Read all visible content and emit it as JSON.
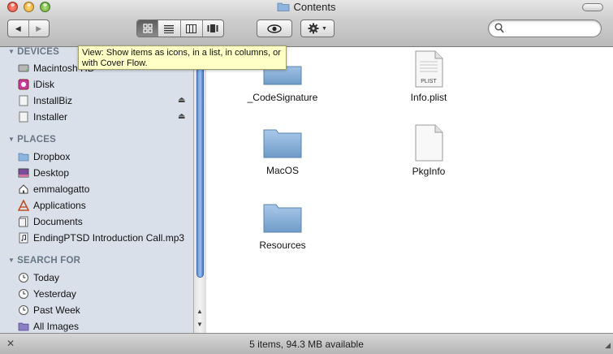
{
  "window": {
    "title": "Contents"
  },
  "toolbar": {
    "back": "◀",
    "forward": "▶",
    "views": [
      {
        "name": "icon-view",
        "active": true
      },
      {
        "name": "list-view",
        "active": false
      },
      {
        "name": "column-view",
        "active": false
      },
      {
        "name": "cover-flow-view",
        "active": false
      }
    ],
    "search_value": ""
  },
  "tooltip": {
    "text": "View: Show items as icons, in a list, in columns, or with Cover Flow."
  },
  "sidebar": {
    "devices_header": "DEVICES",
    "devices": [
      {
        "label": "Macintosh HD",
        "icon": "hard-drive-icon",
        "eject": false
      },
      {
        "label": "iDisk",
        "icon": "idisk-icon",
        "eject": false
      },
      {
        "label": "InstallBiz",
        "icon": "disk-image-icon",
        "eject": true
      },
      {
        "label": "Installer",
        "icon": "disk-image-icon",
        "eject": true
      }
    ],
    "places_header": "PLACES",
    "places": [
      {
        "label": "Dropbox",
        "icon": "folder-icon"
      },
      {
        "label": "Desktop",
        "icon": "desktop-icon"
      },
      {
        "label": "emmalogatto",
        "icon": "home-icon"
      },
      {
        "label": "Applications",
        "icon": "applications-icon"
      },
      {
        "label": "Documents",
        "icon": "documents-icon"
      },
      {
        "label": "EndingPTSD Introduction Call.mp3",
        "icon": "audio-file-icon"
      }
    ],
    "search_header": "SEARCH FOR",
    "searches": [
      {
        "label": "Today",
        "icon": "clock-icon"
      },
      {
        "label": "Yesterday",
        "icon": "clock-icon"
      },
      {
        "label": "Past Week",
        "icon": "clock-icon"
      },
      {
        "label": "All Images",
        "icon": "smart-folder-icon"
      }
    ]
  },
  "files": [
    {
      "label": "_CodeSignature",
      "kind": "folder"
    },
    {
      "label": "Info.plist",
      "kind": "plist",
      "badge": "PLIST"
    },
    {
      "label": "MacOS",
      "kind": "folder"
    },
    {
      "label": "PkgInfo",
      "kind": "document"
    },
    {
      "label": "Resources",
      "kind": "folder"
    }
  ],
  "status": {
    "text": "5 items, 94.3 MB available"
  },
  "colors": {
    "sidebar_bg": "#d9e0ea",
    "tooltip_bg": "#ffffc6",
    "scroll_thumb": "#6f9ddf"
  }
}
